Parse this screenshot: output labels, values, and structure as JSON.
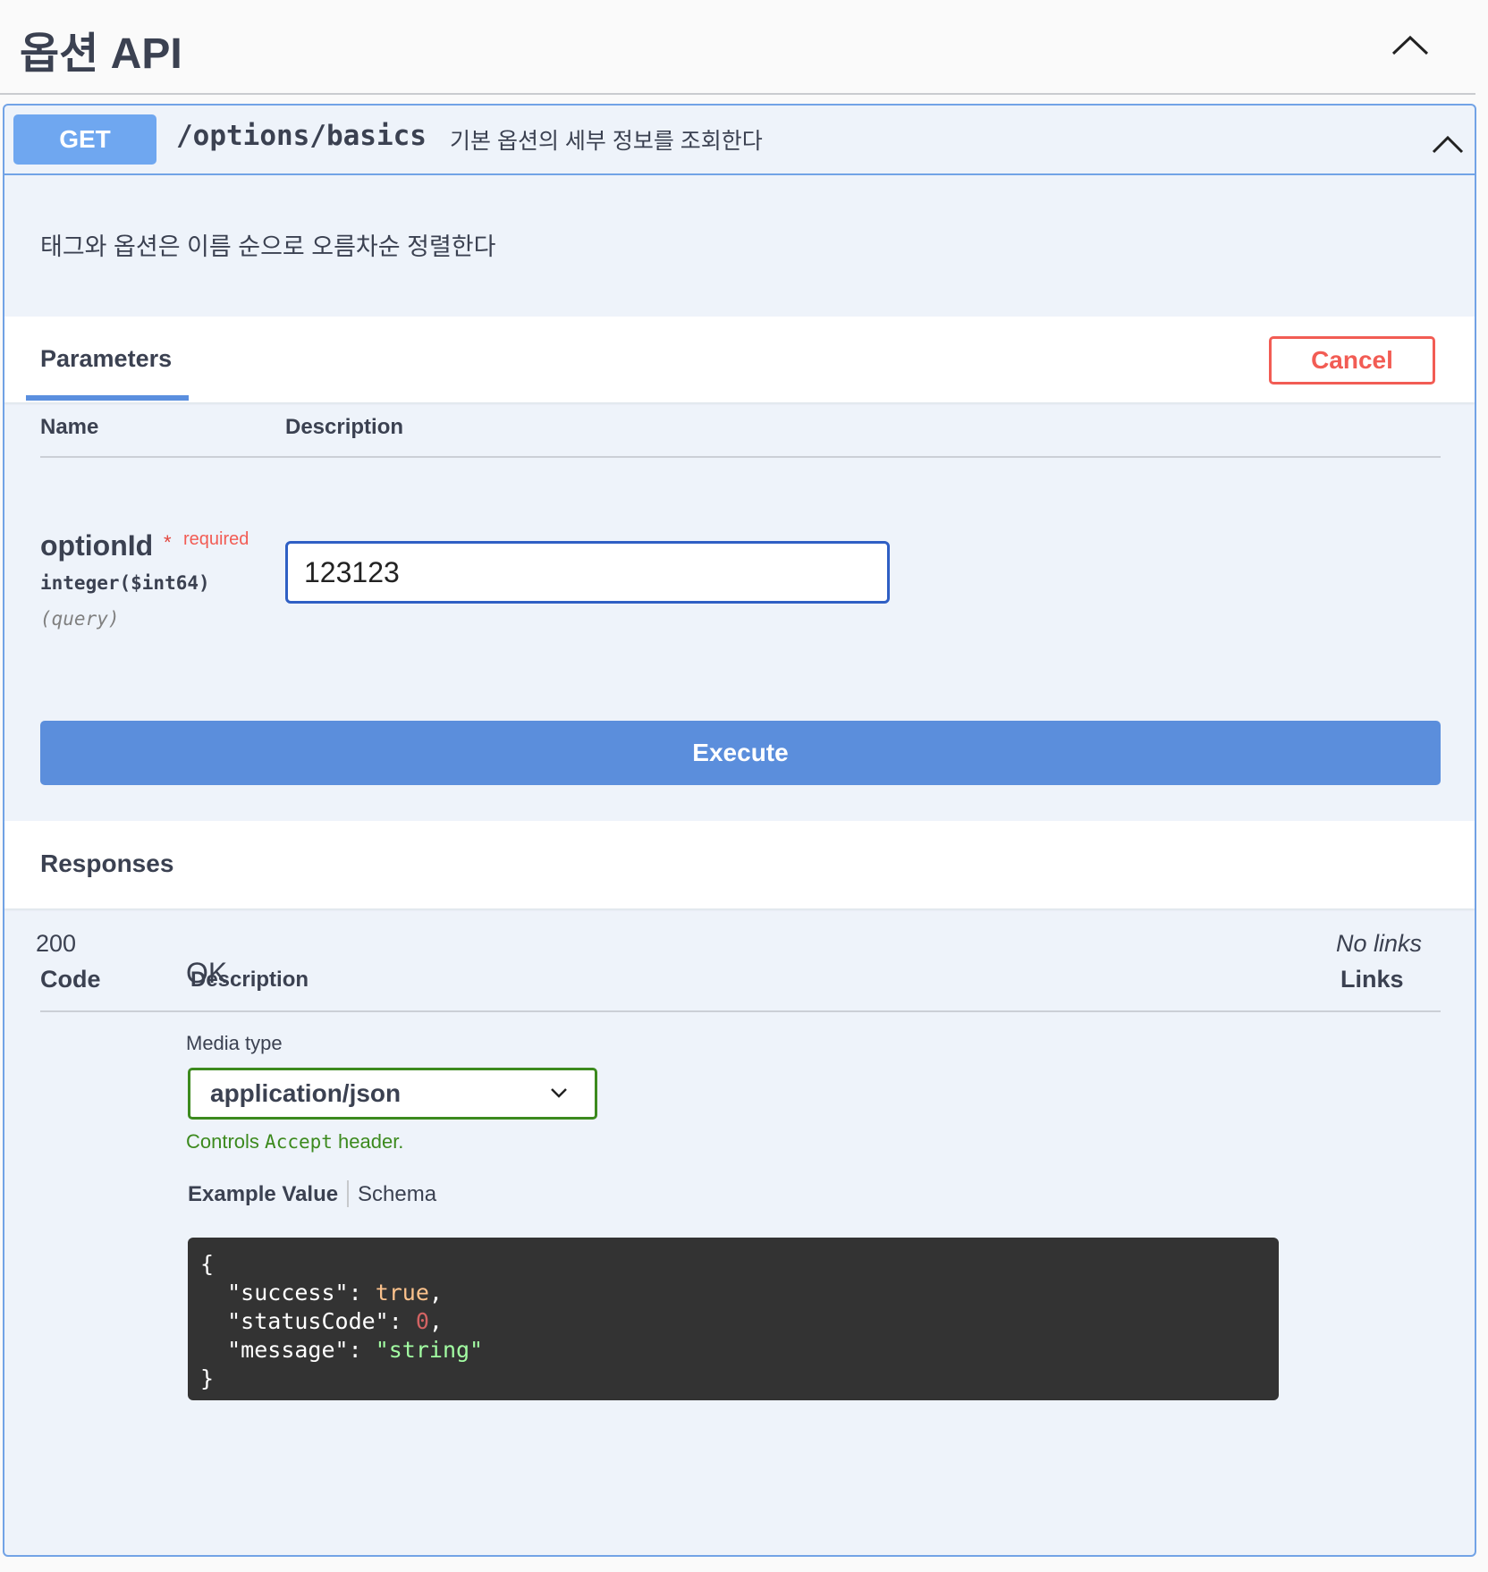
{
  "tag": {
    "title": "옵션 API",
    "toggle_icon": "chevron-up-icon"
  },
  "operation": {
    "method": "GET",
    "path": "/options/basics",
    "summary": "기본 옵션의 세부 정보를 조회한다",
    "description": "태그와 옵션은 이름 순으로 오름차순 정렬한다",
    "colors": {
      "method": "#6fa7f0",
      "border": "#72a3e6",
      "background": "#eef3fa"
    }
  },
  "parameters": {
    "tab_label": "Parameters",
    "cancel_label": "Cancel",
    "col_name": "Name",
    "col_description": "Description",
    "items": [
      {
        "name": "optionId",
        "required_star": "*",
        "required_label": "required",
        "type": "integer($int64)",
        "in": "(query)",
        "value": "123123"
      }
    ],
    "execute_label": "Execute"
  },
  "responses": {
    "title": "Responses",
    "col_code": "Code",
    "col_description": "Description",
    "col_links": "Links",
    "rows": [
      {
        "code": "200",
        "description": "OK",
        "links": "No links",
        "media_type_label": "Media type",
        "media_type_value": "application/json",
        "media_hint_prefix": "Controls ",
        "media_hint_code": "Accept",
        "media_hint_suffix": " header.",
        "tab_example": "Example Value",
        "tab_schema": "Schema",
        "example": {
          "open": "{",
          "k1": "\"success\"",
          "v1": "true",
          "k2": "\"statusCode\"",
          "v2": "0",
          "k3": "\"message\"",
          "v3": "\"string\"",
          "close": "}"
        }
      }
    ]
  }
}
